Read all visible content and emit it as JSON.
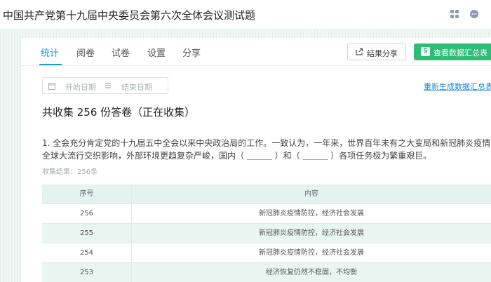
{
  "app": {
    "title": "中国共产党第十九届中央委员会第六次全体会议测试题"
  },
  "tabs": [
    {
      "label": "统计"
    },
    {
      "label": "阅卷"
    },
    {
      "label": "试卷"
    },
    {
      "label": "设置"
    },
    {
      "label": "分享"
    }
  ],
  "toolbar": {
    "share_result_label": "结果分享",
    "view_summary_label": "查看数据汇总表",
    "summary_icon_letter": "S",
    "accent_color": "#2dbd76",
    "link_color": "#1e9bd1"
  },
  "filters": {
    "start_date_placeholder": "开始日期",
    "end_date_placeholder": "结束日期",
    "regenerate_label": "重新生成数据汇总表"
  },
  "summary": {
    "collected_text": "共收集 256 份答卷（正在收集）"
  },
  "question": {
    "text": "1. 全会充分肯定党的十九届五中全会以来中央政治局的工作。一致认为，一年来，世界百年未有之大变局和新冠肺炎疫情全球大流行交织影响，外部环境更趋复杂严峻，国内（ ＿＿＿ ）和（ ＿＿＿ ）各项任务极为繁重艰巨。",
    "result_count": "收集结果：256条"
  },
  "table": {
    "headers": {
      "num": "序号",
      "content": "内容"
    },
    "rows": [
      {
        "num": "256",
        "content": "新冠肺炎疫情防控，经济社会发展"
      },
      {
        "num": "255",
        "content": "新冠肺炎疫情防控，经济社会发展"
      },
      {
        "num": "254",
        "content": "新冠肺炎疫情防控，经济社会发展"
      },
      {
        "num": "253",
        "content": "经济恢复仍然不稳固，不均衡"
      }
    ]
  }
}
